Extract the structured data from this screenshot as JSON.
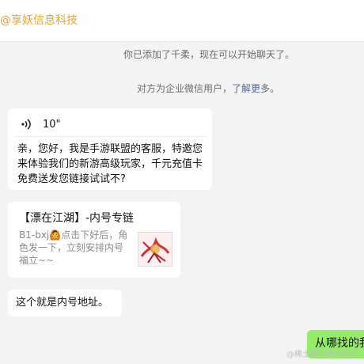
{
  "header": {
    "title": "@享妖信息科技"
  },
  "system_messages": [
    {
      "text": "你已添加了千柔，现在可以开始聊天了。"
    },
    {
      "text": "对方为企业微信用户，",
      "link": "了解更多",
      "suffix": "。"
    }
  ],
  "voice_message": {
    "duration": "10\"",
    "transcript": "亲，您好，我是手游联盟的客服，特邀您来体验我们的新游高级玩家，千元充值卡免费送发您链接试试不?"
  },
  "link_card": {
    "title": "【漂在江湖】-内号专链",
    "description": "B1-bxj🙆点击下好后，角色发一下，立刻安排内号福立~~"
  },
  "text_message": {
    "text": "这个就是内号地址。"
  },
  "my_message": {
    "text": "从哪找的我"
  },
  "watermark": "@稀土掘金技术社区",
  "colors": {
    "background": "#f3f3f3",
    "self_bubble": "#95ec69",
    "brand": "#f0a12a",
    "link": "#576b95"
  }
}
